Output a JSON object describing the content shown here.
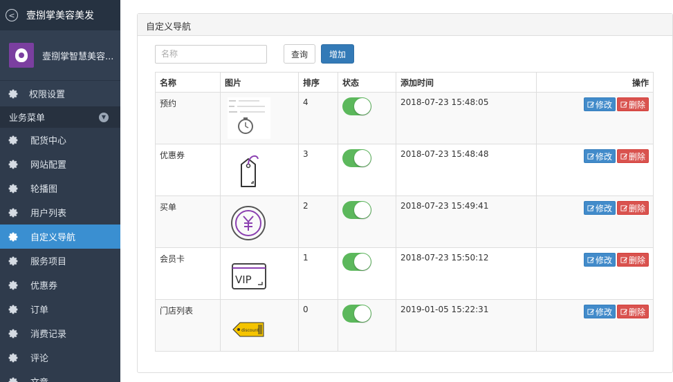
{
  "sidebar": {
    "title": "壹捌掌美容美发",
    "profile_name": "壹捌掌智慧美容...",
    "permission": "权限设置",
    "group": "业务菜单",
    "items": [
      {
        "label": "配货中心",
        "icon": "gear-icon"
      },
      {
        "label": "网站配置",
        "icon": "gear-icon"
      },
      {
        "label": "轮播图",
        "icon": "gear-icon"
      },
      {
        "label": "用户列表",
        "icon": "gear-icon"
      },
      {
        "label": "自定义导航",
        "icon": "gear-icon",
        "active": true
      },
      {
        "label": "服务项目",
        "icon": "gear-icon"
      },
      {
        "label": "优惠券",
        "icon": "gear-icon"
      },
      {
        "label": "订单",
        "icon": "gear-icon"
      },
      {
        "label": "消费记录",
        "icon": "gear-icon"
      },
      {
        "label": "评论",
        "icon": "gear-icon"
      },
      {
        "label": "文章",
        "icon": "gear-icon"
      }
    ],
    "colors": {
      "bg": "#2f3b4c",
      "active": "#3a8fd1"
    }
  },
  "panel": {
    "heading": "自定义导航",
    "search": {
      "placeholder": "名称",
      "value": ""
    },
    "query_label": "查询",
    "add_label": "增加"
  },
  "table": {
    "headers": [
      "名称",
      "图片",
      "排序",
      "状态",
      "添加时间",
      "操作"
    ],
    "rows": [
      {
        "name": "预约",
        "image": "appointment-screenshot-thumbnail",
        "sort": "4",
        "status": true,
        "time": "2018-07-23 15:48:05",
        "edit": "修改",
        "delete": "删除"
      },
      {
        "name": "优惠券",
        "image": "price-tag-icon",
        "sort": "3",
        "status": true,
        "time": "2018-07-23 15:48:48",
        "edit": "修改",
        "delete": "删除"
      },
      {
        "name": "买单",
        "image": "yuan-coin-icon",
        "sort": "2",
        "status": true,
        "time": "2018-07-23 15:49:41",
        "edit": "修改",
        "delete": "删除"
      },
      {
        "name": "会员卡",
        "image": "vip-card-icon",
        "sort": "1",
        "status": true,
        "time": "2018-07-23 15:50:12",
        "edit": "修改",
        "delete": "删除"
      },
      {
        "name": "门店列表",
        "image": "discount-tag-icon",
        "sort": "0",
        "status": true,
        "time": "2019-01-05 15:22:31",
        "edit": "修改",
        "delete": "删除"
      }
    ],
    "colors": {
      "toggle_on": "#5cb85c",
      "edit": "#428bca",
      "delete": "#d9534f"
    }
  }
}
